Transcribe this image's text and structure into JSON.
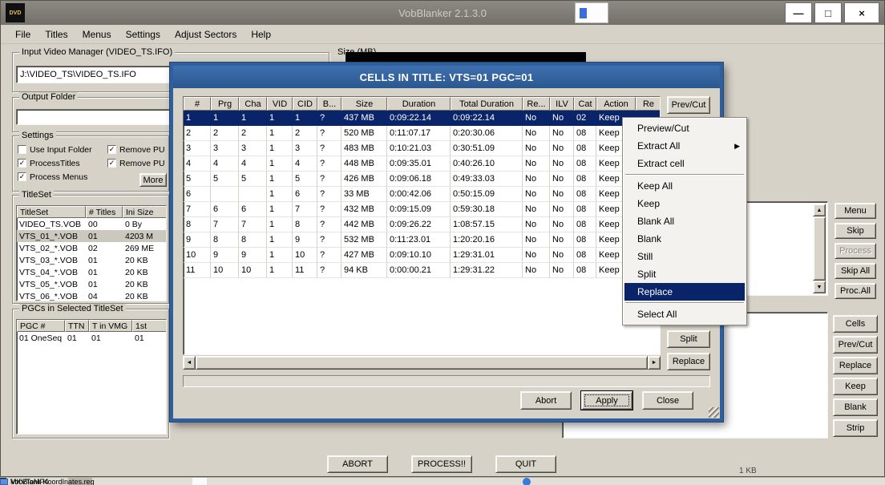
{
  "icons": {
    "minimize": "—",
    "maximize": "□",
    "close": "×",
    "submenu_arrow": "▶",
    "up_arrow": "▲",
    "down_arrow": "▼",
    "left_arrow": "◄",
    "right_arrow": "►",
    "checkmark": "✓",
    "dvd_logo": "DVD"
  },
  "colors": {
    "selection": "#0a246a",
    "dialog_title_bar": "#2f5f9f",
    "window_bg": "#d6d2c8",
    "progress_bar": "#000000"
  },
  "window": {
    "title": "VobBlanker 2.1.3.0",
    "menu": [
      "File",
      "Titles",
      "Menus",
      "Settings",
      "Adjust Sectors",
      "Help"
    ]
  },
  "input_group": {
    "label": "Input Video Manager (VIDEO_TS.IFO)",
    "value": "J:\\VIDEO_TS\\VIDEO_TS.IFO"
  },
  "output_group": {
    "label": "Output Folder",
    "value": ""
  },
  "settings_group": {
    "label": "Settings",
    "checkboxes": [
      {
        "label": "Use Input Folder",
        "checked": false
      },
      {
        "label": "Remove PU",
        "checked": true
      },
      {
        "label": "ProcessTitles",
        "checked": true
      },
      {
        "label": "Remove PU",
        "checked": true
      },
      {
        "label": "Process Menus",
        "checked": true
      }
    ],
    "more_button": "More"
  },
  "titleset_group": {
    "label": "TitleSet",
    "columns": [
      "TitleSet",
      "# Titles",
      "Ini Size"
    ],
    "rows": [
      [
        "VIDEO_TS.VOB",
        "00",
        "0 By"
      ],
      [
        "VTS_01_*.VOB",
        "01",
        "4203 M"
      ],
      [
        "VTS_02_*.VOB",
        "02",
        "269 ME"
      ],
      [
        "VTS_03_*.VOB",
        "01",
        "20 KB"
      ],
      [
        "VTS_04_*.VOB",
        "01",
        "20 KB"
      ],
      [
        "VTS_05_*.VOB",
        "01",
        "20 KB"
      ],
      [
        "VTS_06_*.VOB",
        "04",
        "20 KB"
      ]
    ],
    "selected_index": 1
  },
  "pgc_group": {
    "label": "PGCs in Selected TitleSet",
    "columns": [
      "PGC #",
      "TTN",
      "T in VMG",
      "1st"
    ],
    "rows": [
      [
        "01 OneSeq",
        "01",
        "01",
        "01"
      ]
    ],
    "selected_index": -1
  },
  "size_group": {
    "label": "Size (MB)"
  },
  "right_buttons_top": [
    {
      "label": "Menu"
    },
    {
      "label": "Skip"
    },
    {
      "label": "Process",
      "disabled": true
    },
    {
      "label": "Skip All"
    },
    {
      "label": "Proc.All"
    }
  ],
  "right_buttons_bottom": [
    {
      "label": "Cells"
    },
    {
      "label": "Prev/Cut"
    },
    {
      "label": "Replace"
    },
    {
      "label": "Keep"
    },
    {
      "label": "Blank"
    },
    {
      "label": "Strip"
    }
  ],
  "bottom_buttons": [
    {
      "label": "ABORT"
    },
    {
      "label": "PROCESS!!"
    },
    {
      "label": "QUIT"
    }
  ],
  "dialog": {
    "title": "CELLS IN TITLE: VTS=01 PGC=01",
    "columns": [
      "#",
      "Prg",
      "Cha",
      "VID",
      "CID",
      "B...",
      "Size",
      "Duration",
      "Total Duration",
      "Re...",
      "ILV",
      "Cat",
      "Action",
      "Re"
    ],
    "rows": [
      [
        "1",
        "1",
        "1",
        "1",
        "1",
        "?",
        "437 MB",
        "0:09:22.14",
        "0:09:22.14",
        "No",
        "No",
        "02",
        "Keep",
        ""
      ],
      [
        "2",
        "2",
        "2",
        "1",
        "2",
        "?",
        "520 MB",
        "0:11:07.17",
        "0:20:30.06",
        "No",
        "No",
        "08",
        "Keep",
        ""
      ],
      [
        "3",
        "3",
        "3",
        "1",
        "3",
        "?",
        "483 MB",
        "0:10:21.03",
        "0:30:51.09",
        "No",
        "No",
        "08",
        "Keep",
        ""
      ],
      [
        "4",
        "4",
        "4",
        "1",
        "4",
        "?",
        "448 MB",
        "0:09:35.01",
        "0:40:26.10",
        "No",
        "No",
        "08",
        "Keep",
        ""
      ],
      [
        "5",
        "5",
        "5",
        "1",
        "5",
        "?",
        "426 MB",
        "0:09:06.18",
        "0:49:33.03",
        "No",
        "No",
        "08",
        "Keep",
        ""
      ],
      [
        "6",
        "",
        "",
        "1",
        "6",
        "?",
        "33 MB",
        "0:00:42.06",
        "0:50:15.09",
        "No",
        "No",
        "08",
        "Keep",
        ""
      ],
      [
        "7",
        "6",
        "6",
        "1",
        "7",
        "?",
        "432 MB",
        "0:09:15.09",
        "0:59:30.18",
        "No",
        "No",
        "08",
        "Keep",
        ""
      ],
      [
        "8",
        "7",
        "7",
        "1",
        "8",
        "?",
        "442 MB",
        "0:09:26.22",
        "1:08:57.15",
        "No",
        "No",
        "08",
        "Keep",
        ""
      ],
      [
        "9",
        "8",
        "8",
        "1",
        "9",
        "?",
        "532 MB",
        "0:11:23.01",
        "1:20:20.16",
        "No",
        "No",
        "08",
        "Keep",
        ""
      ],
      [
        "10",
        "9",
        "9",
        "1",
        "10",
        "?",
        "427 MB",
        "0:09:10.10",
        "1:29:31.01",
        "No",
        "No",
        "08",
        "Keep",
        ""
      ],
      [
        "11",
        "10",
        "10",
        "1",
        "11",
        "?",
        "94 KB",
        "0:00:00.21",
        "1:29:31.22",
        "No",
        "No",
        "08",
        "Keep",
        ""
      ]
    ],
    "selected_index": 0,
    "side_buttons": [
      {
        "label": "Prev/Cut"
      },
      {
        "label": "Split"
      },
      {
        "label": "Replace"
      }
    ],
    "bottom_buttons": [
      {
        "label": "Abort"
      },
      {
        "label": "Apply",
        "focused": true
      },
      {
        "label": "Close"
      }
    ]
  },
  "context_menu": {
    "items": [
      {
        "label": "Preview/Cut"
      },
      {
        "label": "Extract All",
        "submenu": true
      },
      {
        "label": "Extract cell",
        "separator_after": true
      },
      {
        "label": "Keep All"
      },
      {
        "label": "Keep"
      },
      {
        "label": "Blank All"
      },
      {
        "label": "Blank"
      },
      {
        "label": "Still"
      },
      {
        "label": "Split"
      },
      {
        "label": "Replace",
        "highlighted": true,
        "separator_after": true
      },
      {
        "label": "Select All"
      }
    ]
  },
  "taskbar": {
    "items": [
      {
        "icon": "folder",
        "label": "MKVToMP4"
      },
      {
        "icon": "reg",
        "label": "VobBlank KoordInates.reg"
      }
    ]
  },
  "fragments": {
    "bottom_right_text": "1 KB"
  }
}
